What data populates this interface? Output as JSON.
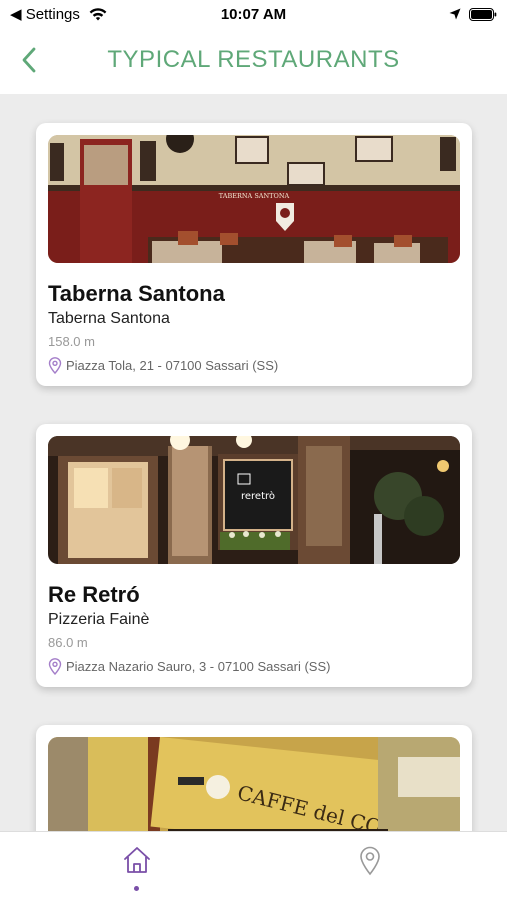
{
  "status_bar": {
    "back_app": "◀ Settings",
    "time": "10:07 AM"
  },
  "header": {
    "title": "TYPICAL RESTAURANTS"
  },
  "restaurants": [
    {
      "name": "Taberna Santona",
      "subtitle": "Taberna Santona",
      "distance": "158.0 m",
      "address": "Piazza Tola, 21 - 07100 Sassari (SS)",
      "sign_text": "TABERNA SANTONA"
    },
    {
      "name": "Re Retró",
      "subtitle": "Pizzeria Fainè",
      "distance": "86.0 m",
      "address": "Piazza Nazario Sauro, 3 - 07100 Sassari (SS)",
      "sign_text": "reretrò"
    },
    {
      "sign_text": "CAFFE del CORSO"
    }
  ],
  "tab_bar": {
    "items": [
      {
        "icon": "home-icon",
        "selected": true
      },
      {
        "icon": "map-pin-icon",
        "selected": false
      }
    ]
  },
  "colors": {
    "accent_green": "#5fa878",
    "accent_purple": "#7a4fa8"
  }
}
